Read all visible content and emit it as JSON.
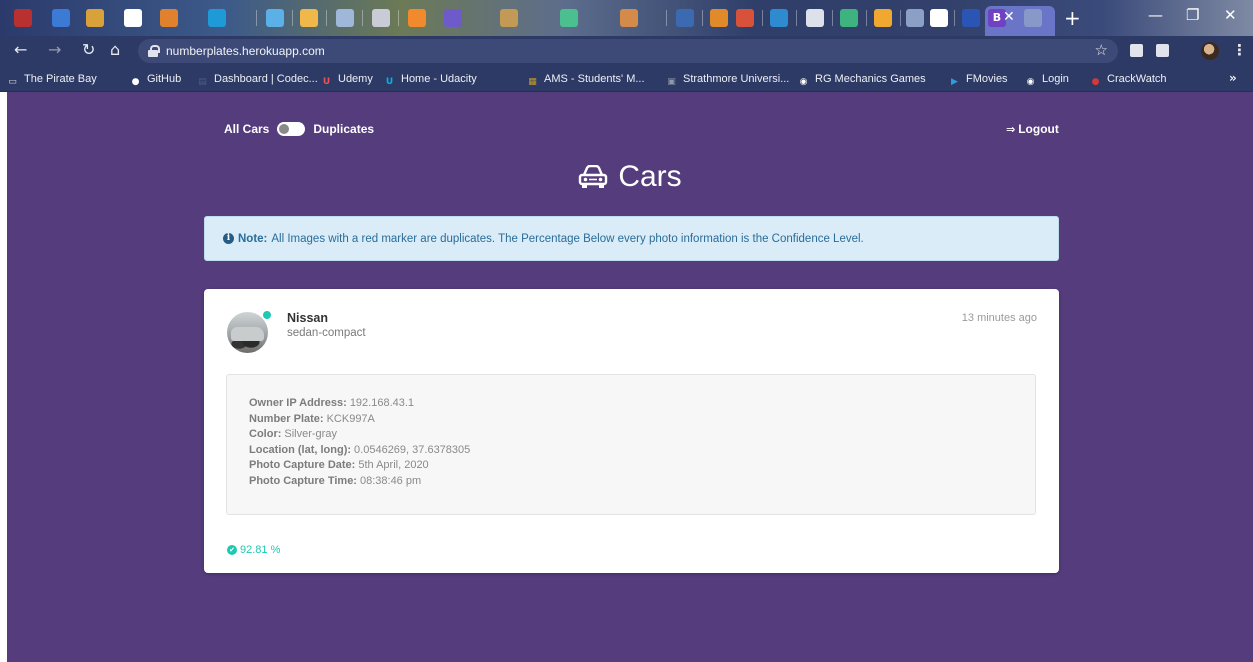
{
  "browser": {
    "url": "numberplates.herokuapp.com",
    "bookmarks": [
      {
        "label": "The Pirate Bay",
        "icon": "monitor-icon",
        "color": "#d6d6d6"
      },
      {
        "label": "GitHub",
        "icon": "github-icon",
        "color": "#ffffff"
      },
      {
        "label": "Dashboard | Codec...",
        "icon": "codecademy-icon",
        "color": "#4a5b8c"
      },
      {
        "label": "Udemy",
        "icon": "udemy-icon",
        "color": "#ec5252"
      },
      {
        "label": "Home - Udacity",
        "icon": "udacity-icon",
        "color": "#02b3e4"
      },
      {
        "label": "AMS - Students' M...",
        "icon": "ams-icon",
        "color": "#c69a2d"
      },
      {
        "label": "Strathmore Universi...",
        "icon": "strathmore-icon",
        "color": "#8f98a8"
      },
      {
        "label": "RG Mechanics Games",
        "icon": "globe-icon",
        "color": "#ffffff"
      },
      {
        "label": "FMovies",
        "icon": "play-icon",
        "color": "#2f9be0"
      },
      {
        "label": "Login",
        "icon": "globe-icon",
        "color": "#ffffff"
      },
      {
        "label": "CrackWatch",
        "icon": "crackwatch-icon",
        "color": "#d23a3a"
      }
    ]
  },
  "nav": {
    "all_cars_label": "All Cars",
    "duplicates_label": "Duplicates",
    "logout_label": "Logout"
  },
  "page": {
    "title": "Cars"
  },
  "alert": {
    "strong": "Note:",
    "text": "All Images with a red marker are duplicates. The Percentage Below every photo information is the Confidence Level."
  },
  "car": {
    "name": "Nissan",
    "type": "sedan-compact",
    "time_ago": "13 minutes ago",
    "status_color": "#1ec8b1",
    "details": [
      {
        "key": "Owner IP Address:",
        "value": "192.168.43.1"
      },
      {
        "key": "Number Plate:",
        "value": "KCK997A"
      },
      {
        "key": "Color:",
        "value": "Silver-gray"
      },
      {
        "key": "Location (lat, long):",
        "value": "0.0546269, 37.6378305"
      },
      {
        "key": "Photo Capture Date:",
        "value": "5th April, 2020"
      },
      {
        "key": "Photo Capture Time:",
        "value": "08:38:46 pm"
      }
    ],
    "confidence": "92.81 %"
  },
  "colors": {
    "page_bg": "#553c7c",
    "alert_bg": "#d9ecf8",
    "alert_text": "#2a6d99",
    "accent": "#1ec8b1"
  }
}
